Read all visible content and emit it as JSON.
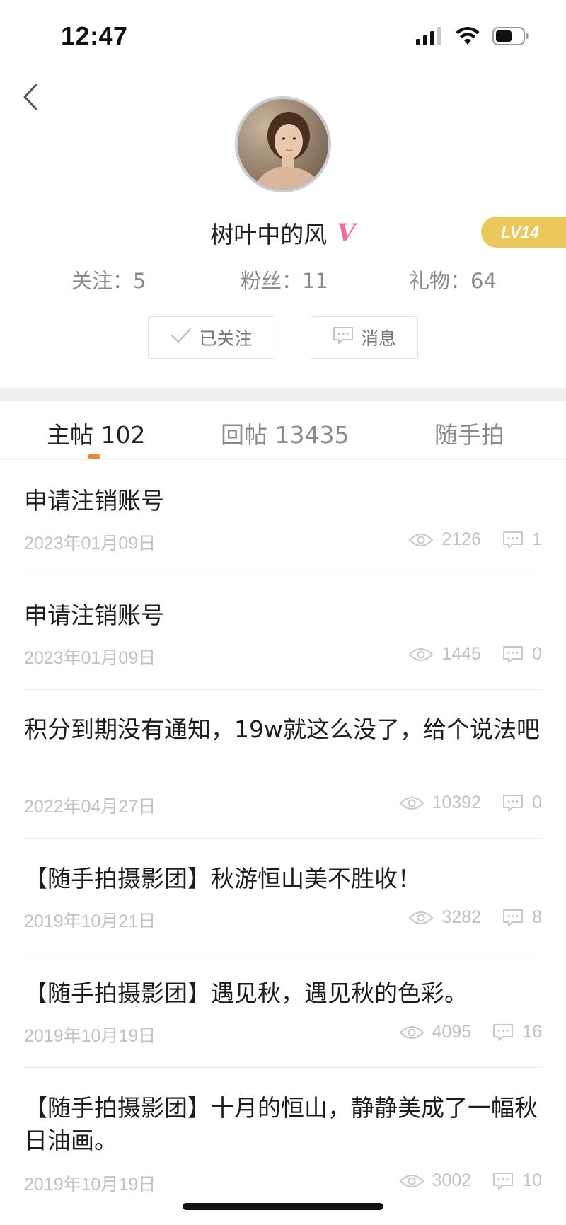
{
  "status_bar": {
    "time": "12:47"
  },
  "profile": {
    "username": "树叶中的风",
    "verified_mark": "V",
    "level": "LV14",
    "stats": {
      "follow": "关注：5",
      "fans": "粉丝：11",
      "gifts": "礼物：64"
    },
    "buttons": {
      "followed_label": "已关注",
      "message_label": "消息"
    }
  },
  "tabs": [
    {
      "label": "主帖 102",
      "active": true
    },
    {
      "label": "回帖 13435",
      "active": false
    },
    {
      "label": "随手拍",
      "active": false
    }
  ],
  "posts": [
    {
      "title": "申请注销账号",
      "date": "2023年01月09日",
      "views": "2126",
      "comments": "1"
    },
    {
      "title": "申请注销账号",
      "date": "2023年01月09日",
      "views": "1445",
      "comments": "0"
    },
    {
      "title": "积分到期没有通知，19w就这么没了，给个说法吧",
      "date": "2022年04月27日",
      "views": "10392",
      "comments": "0"
    },
    {
      "title": "【随手拍摄影团】秋游恒山美不胜收！",
      "date": "2019年10月21日",
      "views": "3282",
      "comments": "8"
    },
    {
      "title": "【随手拍摄影团】遇见秋，遇见秋的色彩。",
      "date": "2019年10月19日",
      "views": "4095",
      "comments": "16"
    },
    {
      "title": "【随手拍摄影团】十月的恒山，静静美成了一幅秋日油画。",
      "date": "2019年10月19日",
      "views": "3002",
      "comments": "10"
    }
  ],
  "colors": {
    "accent": "#f0892e",
    "level_badge": "#ebc85b",
    "verified": "#ef6f9a",
    "muted_text": "#8a8a8a",
    "meta_text": "#c2c2c2"
  },
  "icons": [
    "chevron-left-icon",
    "signal-icon",
    "wifi-icon",
    "battery-icon",
    "check-icon",
    "message-icon",
    "eye-icon",
    "comment-icon"
  ]
}
